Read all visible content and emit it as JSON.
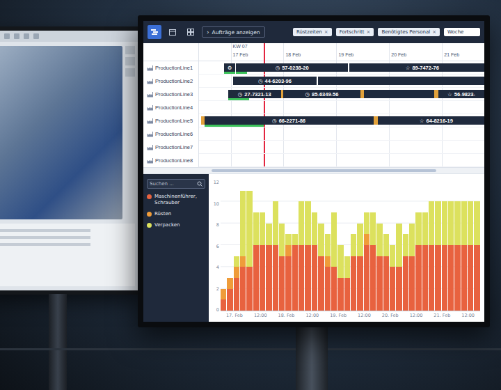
{
  "toolbar": {
    "views": [
      {
        "kind": "gantt",
        "selected": true
      },
      {
        "kind": "calendar",
        "selected": false
      },
      {
        "kind": "grid",
        "selected": false
      }
    ],
    "toggle": {
      "icon": "›",
      "label": "Aufträge anzeigen"
    },
    "filters": [
      {
        "label": "Rüstzeiten",
        "remove": "×"
      },
      {
        "label": "Fortschritt",
        "remove": "×"
      },
      {
        "label": "Benötigtes Personal",
        "remove": "×"
      }
    ],
    "range": {
      "value": "Woche"
    }
  },
  "gantt": {
    "visible_from": 16.4,
    "visible_to": 21.8,
    "week": {
      "label": "KW 07",
      "day": 17
    },
    "dates": [
      {
        "label": "17 Feb",
        "day": 17
      },
      {
        "label": "18 Feb",
        "day": 18
      },
      {
        "label": "19 Feb",
        "day": 19
      },
      {
        "label": "20 Feb",
        "day": 20
      },
      {
        "label": "21 Feb",
        "day": 21
      }
    ],
    "now": 17.62,
    "lines": [
      {
        "name": "ProductionLine1",
        "bars": [
          {
            "icon": "⚙",
            "start": 16.88,
            "end": 17.08,
            "progress": 1
          },
          {
            "icon": "◷",
            "label": "57-0238-20",
            "start": 17.1,
            "end": 19.22,
            "progress": 0.1
          },
          {
            "icon": "☆",
            "label": "89-7472-76",
            "start": 19.25,
            "end": 22,
            "progress": 0
          }
        ],
        "setups": []
      },
      {
        "name": "ProductionLine2",
        "bars": [
          {
            "icon": "◷",
            "label": "44-6203-96",
            "start": 17.05,
            "end": 18.62,
            "progress": 0
          },
          {
            "start": 18.65,
            "end": 22,
            "progress": 0
          }
        ],
        "setups": []
      },
      {
        "name": "ProductionLine3",
        "bars": [
          {
            "icon": "◷",
            "label": "27-7321-13",
            "start": 16.95,
            "end": 17.95,
            "progress": 0.4
          },
          {
            "icon": "◷",
            "label": "85-6349-56",
            "start": 18.0,
            "end": 19.45,
            "progress": 0
          },
          {
            "start": 19.52,
            "end": 20.85,
            "progress": 0
          },
          {
            "icon": "☆",
            "label": "56-9823-",
            "start": 20.93,
            "end": 21.8,
            "progress": 0
          }
        ],
        "setups": [
          {
            "start": 17.95,
            "end": 18.0
          },
          {
            "start": 19.45,
            "end": 19.52
          },
          {
            "start": 20.85,
            "end": 20.93
          }
        ]
      },
      {
        "name": "ProductionLine4",
        "bars": [],
        "setups": []
      },
      {
        "name": "ProductionLine5",
        "bars": [
          {
            "icon": "◷",
            "label": "66-2271-86",
            "start": 16.5,
            "end": 19.7,
            "progress": 0.35
          },
          {
            "icon": "☆",
            "label": "64-8216-19",
            "start": 19.78,
            "end": 22,
            "progress": 0
          }
        ],
        "setups": [
          {
            "start": 16.44,
            "end": 16.5
          },
          {
            "start": 19.7,
            "end": 19.78
          }
        ]
      },
      {
        "name": "ProductionLine6",
        "bars": [],
        "setups": []
      },
      {
        "name": "ProductionLine7",
        "bars": [],
        "setups": []
      },
      {
        "name": "ProductionLine8",
        "bars": [],
        "setups": []
      }
    ],
    "scroll": {
      "offset": 0.2,
      "level": 0.66
    }
  },
  "legend": {
    "search": {
      "placeholder": "Suchen ..."
    }
  },
  "chart": {
    "y_ticks": [
      "12",
      "10",
      "8",
      "6",
      "4",
      "2",
      "0"
    ],
    "x_ticks": [
      "17. Feb",
      "12:00",
      "18. Feb",
      "12:00",
      "19. Feb",
      "12:00",
      "20. Feb",
      "12:00",
      "21. Feb",
      "12:00"
    ],
    "series": [
      {
        "name": "Maschinenführer, Schrauber",
        "color": "#e8623f",
        "values": [
          1,
          2,
          3,
          4,
          4,
          6,
          6,
          6,
          6,
          5,
          5,
          6,
          6,
          6,
          6,
          5,
          4,
          4,
          3,
          3,
          5,
          5,
          6,
          6,
          5,
          5,
          4,
          4,
          5,
          5,
          6,
          6,
          6,
          6,
          6,
          6,
          6,
          6,
          6,
          6
        ]
      },
      {
        "name": "Rüsten",
        "color": "#ef9c3a",
        "values": [
          1,
          1,
          1,
          1,
          0,
          0,
          0,
          0,
          0,
          0,
          1,
          0,
          0,
          0,
          0,
          0,
          1,
          0,
          0,
          0,
          0,
          0,
          1,
          0,
          0,
          0,
          0,
          0,
          0,
          0,
          0,
          0,
          0,
          0,
          0,
          0,
          0,
          0,
          0,
          0
        ]
      },
      {
        "name": "Verpacken",
        "color": "#dce15e",
        "values": [
          0,
          0,
          1,
          6,
          7,
          3,
          3,
          2,
          4,
          3,
          1,
          1,
          4,
          4,
          3,
          3,
          2,
          5,
          3,
          2,
          2,
          3,
          2,
          3,
          3,
          2,
          2,
          4,
          2,
          3,
          3,
          3,
          4,
          4,
          4,
          4,
          4,
          4,
          4,
          4
        ]
      }
    ]
  }
}
